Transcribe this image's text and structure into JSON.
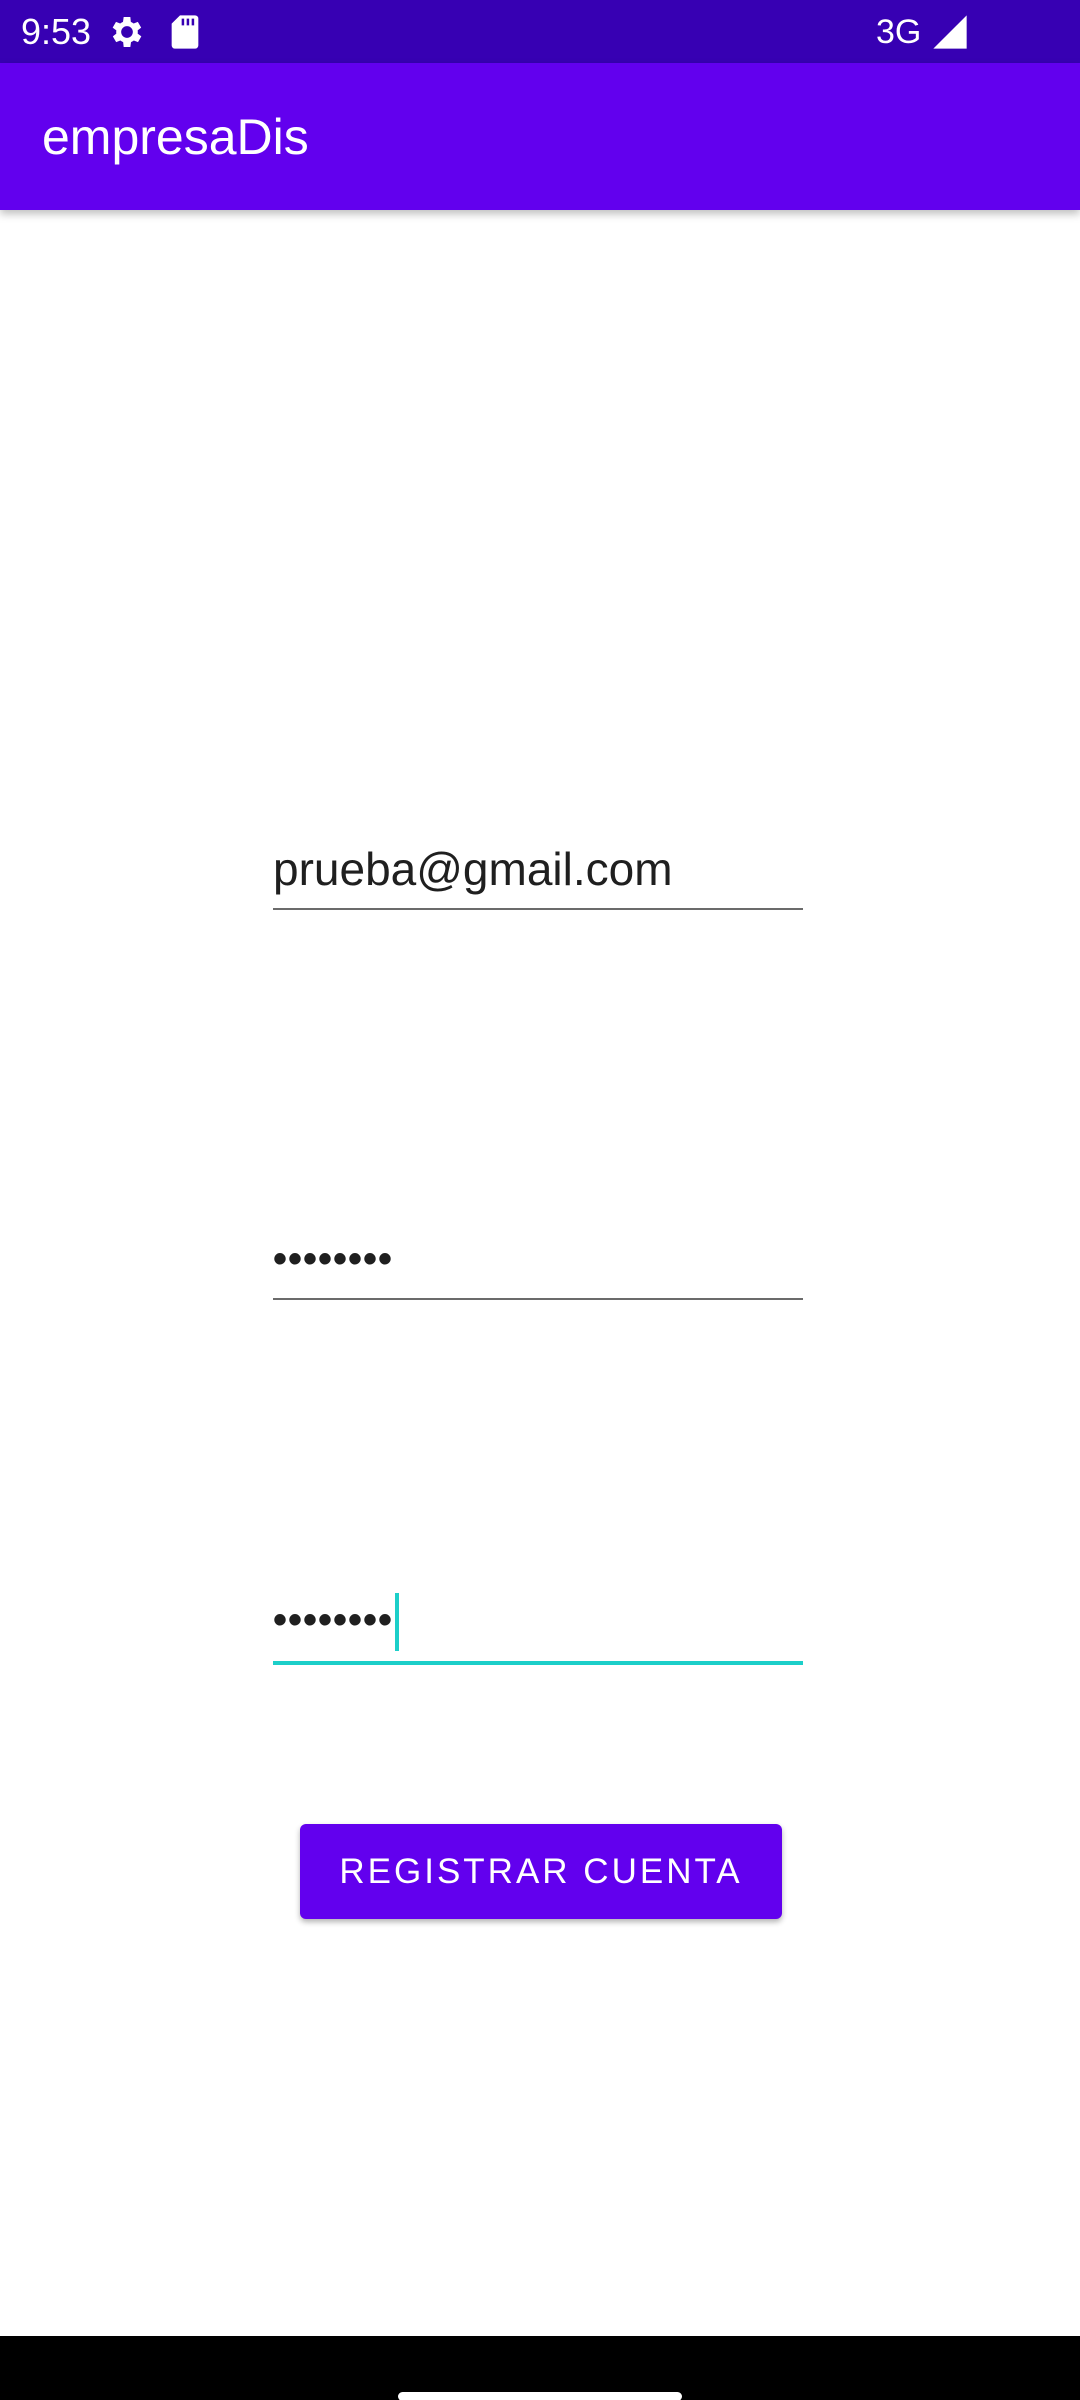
{
  "status_bar": {
    "time": "9:53",
    "network": "3G",
    "icons": [
      "gear-icon",
      "sd-card-icon",
      "signal-icon"
    ]
  },
  "app_bar": {
    "title": "empresaDis"
  },
  "form": {
    "email_value": "prueba@gmail.com",
    "password_value": "••••••••",
    "confirm_password_value": "••••••••",
    "register_button_label": "REGISTRAR CUENTA"
  },
  "colors": {
    "status_bar": "#3700b3",
    "primary": "#6200ee",
    "focus_accent": "#1ccfc9"
  }
}
